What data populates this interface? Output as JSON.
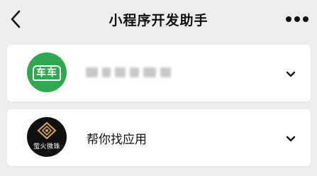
{
  "nav": {
    "title": "小程序开发助手",
    "back_icon": "chevron-left-icon",
    "more_icon": "more-dots-icon"
  },
  "items": [
    {
      "avatar_text": "车车",
      "avatar_color": "#2fa84f",
      "name": "",
      "name_blurred": true,
      "expand_icon": "chevron-down-icon"
    },
    {
      "avatar_text": "萤火微珠",
      "avatar_color": "#111111",
      "name": "帮你找应用",
      "name_blurred": false,
      "expand_icon": "chevron-down-icon"
    }
  ]
}
